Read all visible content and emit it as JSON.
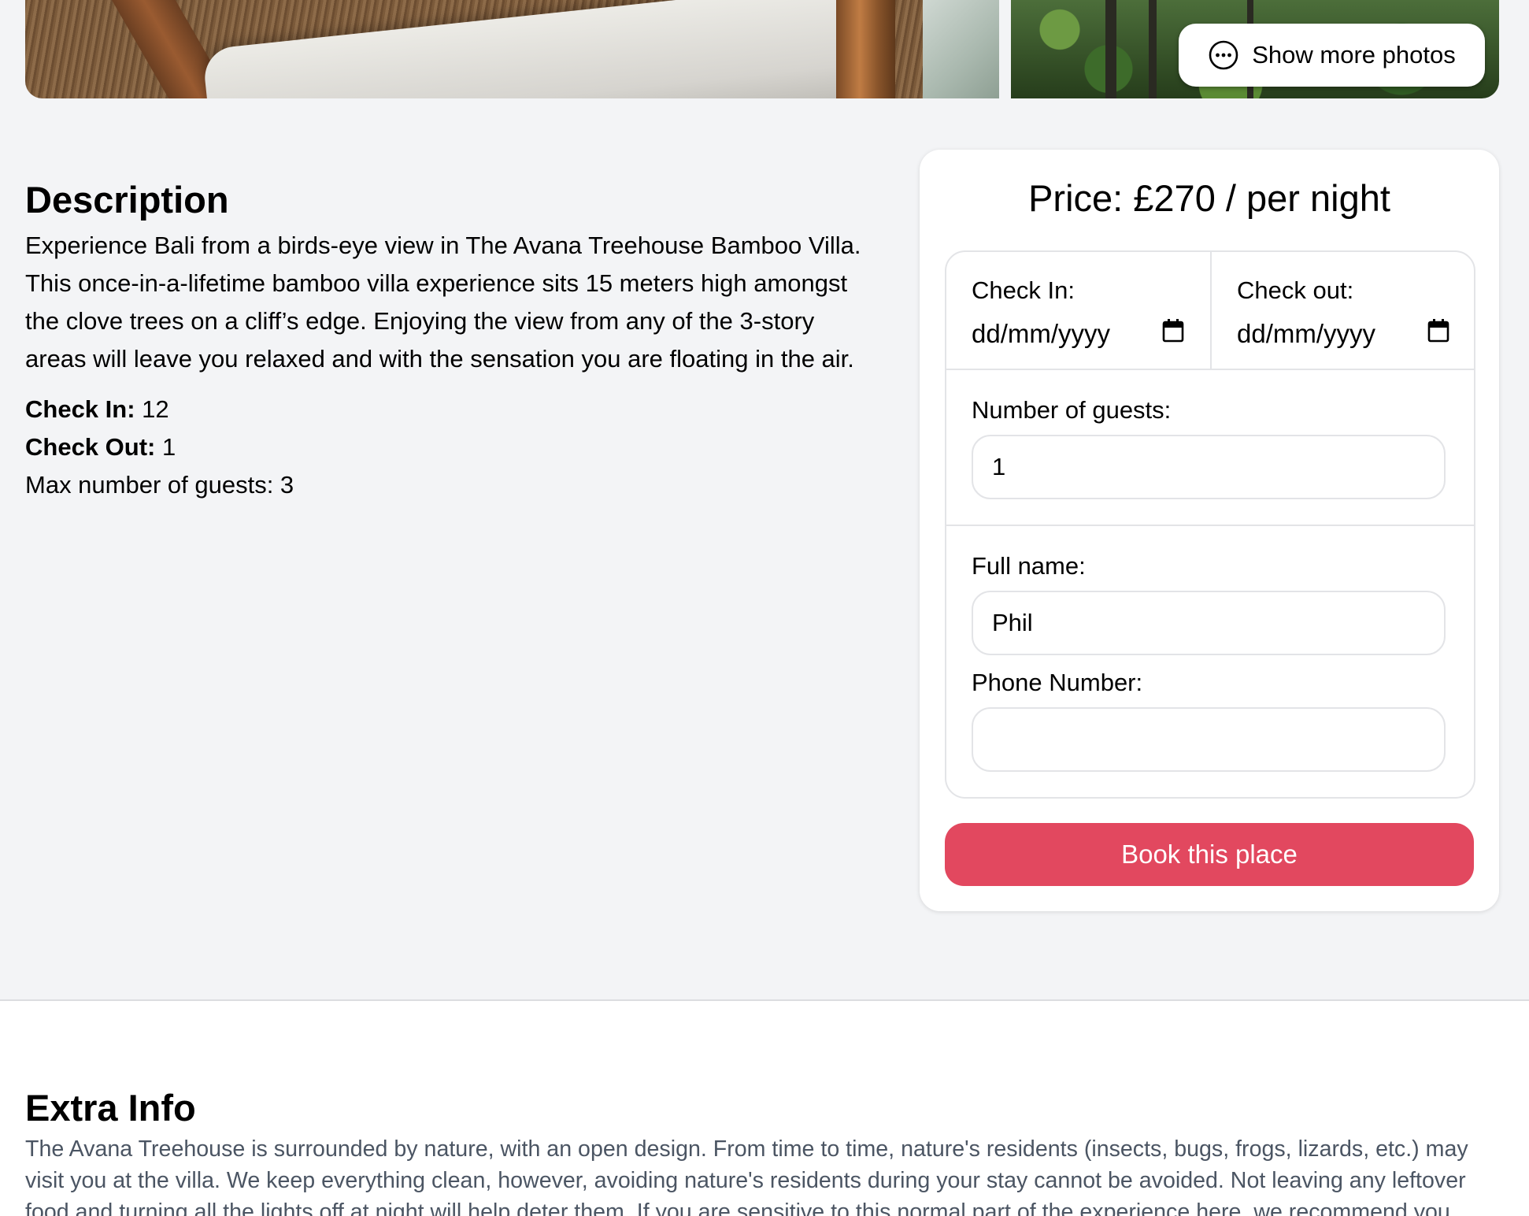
{
  "gallery": {
    "show_more_label": "Show more photos",
    "show_more_icon": "ellipsis-circle-icon"
  },
  "description": {
    "heading": "Description",
    "text": "Experience Bali from a birds-eye view in The Avana Treehouse Bamboo Villa. This once-in-a-lifetime bamboo villa experience sits 15 meters high amongst the clove trees on a cliff’s edge. Enjoying the view from any of the 3-story areas will leave you relaxed and with the sensation you are floating in the air.",
    "check_in_label": "Check In:",
    "check_in_value": "12",
    "check_out_label": "Check Out:",
    "check_out_value": "1",
    "max_guests_text": "Max number of guests: 3"
  },
  "booking": {
    "price_text": "Price: £270 / per night",
    "check_in_label": "Check In:",
    "check_in_placeholder": "dd/mm/yyyy",
    "check_out_label": "Check out:",
    "check_out_placeholder": "dd/mm/yyyy",
    "calendar_icon": "calendar-icon",
    "guests_label": "Number of guests:",
    "guests_value": "1",
    "name_label": "Full name:",
    "name_value": "Phil",
    "phone_label": "Phone Number:",
    "phone_value": "",
    "book_label": "Book this place",
    "accent_color": "#e2485f"
  },
  "extra": {
    "heading": "Extra Info",
    "text": "The Avana Treehouse is surrounded by nature, with an open design. From time to time, nature's residents (insects, bugs, frogs, lizards, etc.) may visit you at the villa. We keep everything clean, however, avoiding nature's residents during your stay cannot be avoided. Not leaving any leftover food and turning all the lights off at night will help deter them. If you are sensitive to this normal part of the experience here, we recommend you"
  }
}
